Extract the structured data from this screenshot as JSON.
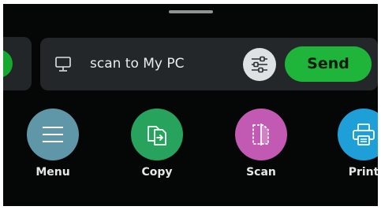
{
  "shortcut": {
    "label": "scan to My PC",
    "send_label": "Send",
    "icon": "desktop-computer-icon",
    "settings_icon": "sliders-icon"
  },
  "apps": [
    {
      "label": "Menu",
      "icon": "hamburger-menu-icon",
      "color": "#5f97a8"
    },
    {
      "label": "Copy",
      "icon": "copy-documents-icon",
      "color": "#27a35d"
    },
    {
      "label": "Scan",
      "icon": "scan-document-icon",
      "color": "#c259b2"
    },
    {
      "label": "Print",
      "icon": "printer-icon",
      "color": "#1e9fd8"
    }
  ],
  "colors": {
    "background": "#050606",
    "card": "#242729",
    "accent_green": "#1fb43a"
  }
}
